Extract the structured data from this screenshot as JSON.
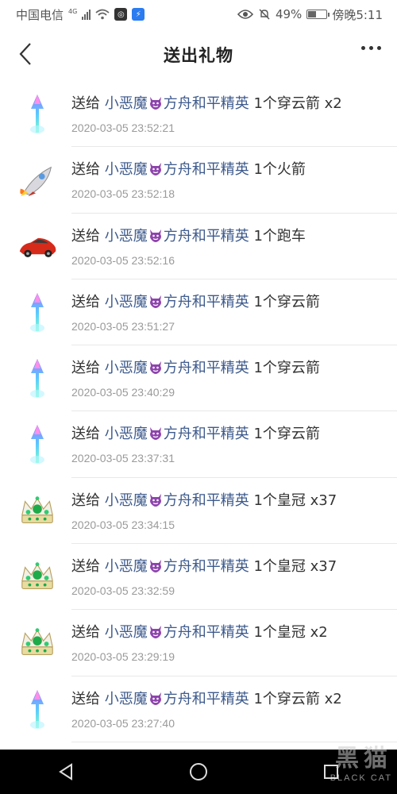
{
  "status_bar": {
    "carrier": "中国电信",
    "network_tag": "4G",
    "battery": "49%",
    "battery_level": 0.49,
    "time": "傍晚5:11"
  },
  "header": {
    "title": "送出礼物"
  },
  "records": [
    {
      "prefix": "送给",
      "recipient_a": "小恶魔",
      "recipient_b": "方舟和平精英",
      "gift": "1个穿云箭 x2",
      "time": "2020-03-05 23:52:21",
      "gift_icon": "arrow-gift-icon"
    },
    {
      "prefix": "送给",
      "recipient_a": "小恶魔",
      "recipient_b": "方舟和平精英",
      "gift": "1个火箭",
      "time": "2020-03-05 23:52:18",
      "gift_icon": "rocket-gift-icon"
    },
    {
      "prefix": "送给",
      "recipient_a": "小恶魔",
      "recipient_b": "方舟和平精英",
      "gift": "1个跑车",
      "time": "2020-03-05 23:52:16",
      "gift_icon": "sports-car-gift-icon"
    },
    {
      "prefix": "送给",
      "recipient_a": "小恶魔",
      "recipient_b": "方舟和平精英",
      "gift": "1个穿云箭",
      "time": "2020-03-05 23:51:27",
      "gift_icon": "arrow-gift-icon"
    },
    {
      "prefix": "送给",
      "recipient_a": "小恶魔",
      "recipient_b": "方舟和平精英",
      "gift": "1个穿云箭",
      "time": "2020-03-05 23:40:29",
      "gift_icon": "arrow-gift-icon"
    },
    {
      "prefix": "送给",
      "recipient_a": "小恶魔",
      "recipient_b": "方舟和平精英",
      "gift": "1个穿云箭",
      "time": "2020-03-05 23:37:31",
      "gift_icon": "arrow-gift-icon"
    },
    {
      "prefix": "送给",
      "recipient_a": "小恶魔",
      "recipient_b": "方舟和平精英",
      "gift": "1个皇冠 x37",
      "time": "2020-03-05 23:34:15",
      "gift_icon": "crown-gift-icon"
    },
    {
      "prefix": "送给",
      "recipient_a": "小恶魔",
      "recipient_b": "方舟和平精英",
      "gift": "1个皇冠 x37",
      "time": "2020-03-05 23:32:59",
      "gift_icon": "crown-gift-icon"
    },
    {
      "prefix": "送给",
      "recipient_a": "小恶魔",
      "recipient_b": "方舟和平精英",
      "gift": "1个皇冠 x2",
      "time": "2020-03-05 23:29:19",
      "gift_icon": "crown-gift-icon"
    },
    {
      "prefix": "送给",
      "recipient_a": "小恶魔",
      "recipient_b": "方舟和平精英",
      "gift": "1个穿云箭 x2",
      "time": "2020-03-05 23:27:40",
      "gift_icon": "arrow-gift-icon"
    }
  ],
  "watermark": {
    "big": "黑猫",
    "small": "BLACK CAT"
  },
  "colors": {
    "recipient": "#3d5a8c",
    "timestamp": "#9a9a9a",
    "divider": "#e8e8e8"
  }
}
